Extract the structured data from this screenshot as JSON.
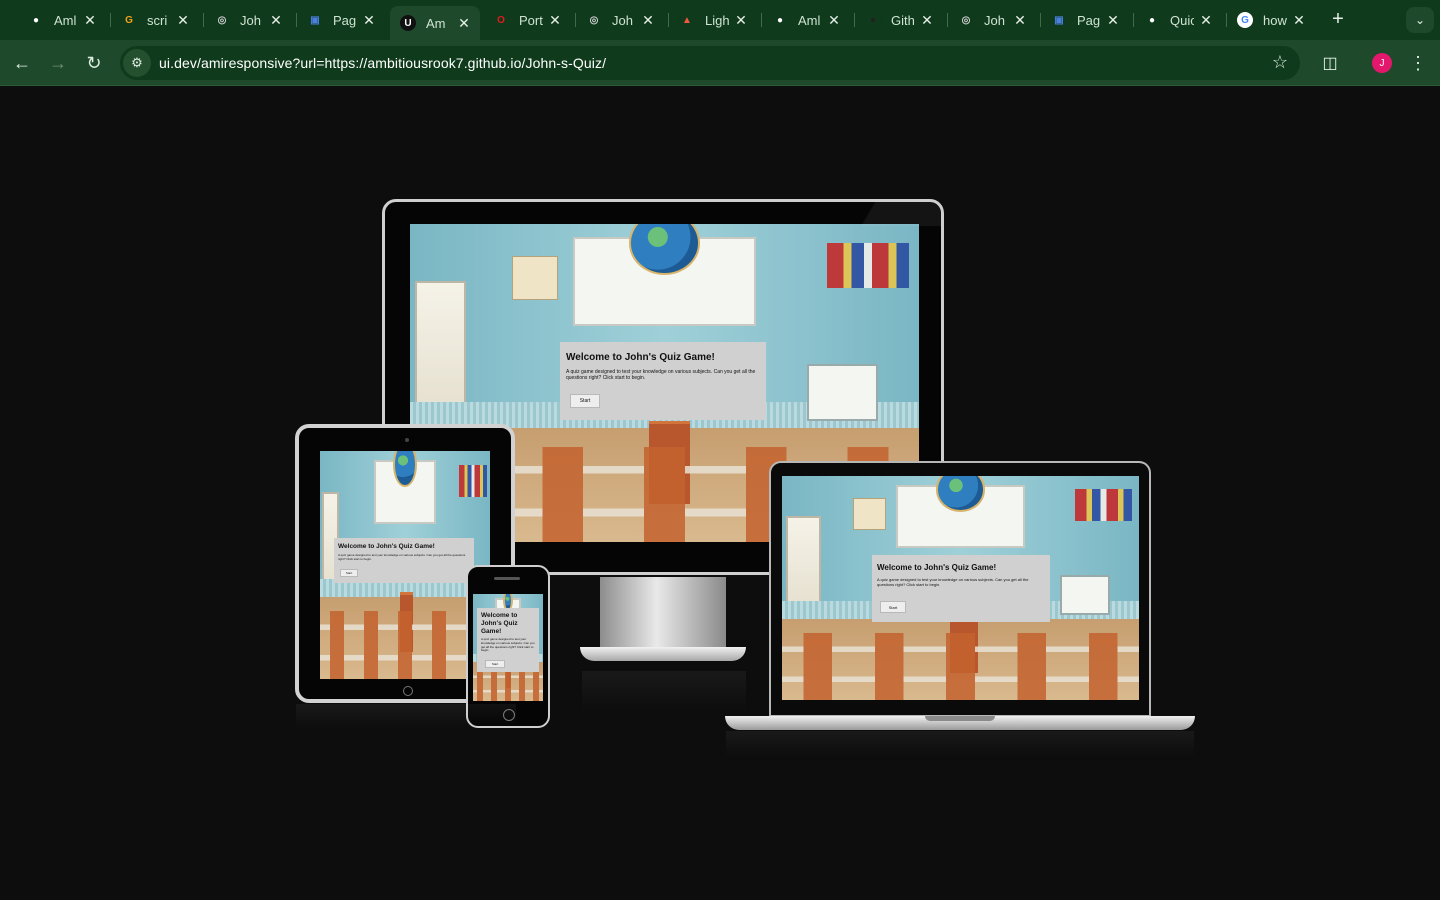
{
  "browser": {
    "tabs": [
      {
        "title": "Aml",
        "favicon": "github-icon",
        "color": "#ffffff",
        "bg": "#0f3a1c"
      },
      {
        "title": "scri",
        "favicon": "grammarly-icon",
        "color": "#f0a21a",
        "bg": "#0f3a1c"
      },
      {
        "title": "Joh",
        "favicon": "globe-icon",
        "color": "#cfcfcf",
        "bg": "#0f3a1c"
      },
      {
        "title": "Pag",
        "favicon": "pages-icon",
        "color": "#4a7fe0",
        "bg": "#0f3a1c"
      },
      {
        "title": "Am",
        "favicon": "ui-dev-icon",
        "color": "#ffffff",
        "bg": "#111111",
        "active": true
      },
      {
        "title": "Port",
        "favicon": "opera-icon",
        "color": "#e21b1b",
        "bg": "#0f3a1c"
      },
      {
        "title": "Joh",
        "favicon": "globe-icon",
        "color": "#cfcfcf",
        "bg": "#0f3a1c"
      },
      {
        "title": "Ligh",
        "favicon": "lighthouse-icon",
        "color": "#ee5b3a",
        "bg": "#0f3a1c"
      },
      {
        "title": "Aml",
        "favicon": "github-icon",
        "color": "#ffffff",
        "bg": "#0f3a1c"
      },
      {
        "title": "Gith",
        "favicon": "github-dark-icon",
        "color": "#222222",
        "bg": "#0f3a1c"
      },
      {
        "title": "Joh",
        "favicon": "globe-icon",
        "color": "#cfcfcf",
        "bg": "#0f3a1c"
      },
      {
        "title": "Pag",
        "favicon": "pages-icon",
        "color": "#4a7fe0",
        "bg": "#0f3a1c"
      },
      {
        "title": "Quic",
        "favicon": "github-icon",
        "color": "#ffffff",
        "bg": "#0f3a1c"
      },
      {
        "title": "how",
        "favicon": "google-icon",
        "color": "#4285f4",
        "bg": "#ffffff"
      }
    ],
    "url": "ui.dev/amiresponsive?url=https://ambitiousrook7.github.io/John-s-Quiz/",
    "avatar_letter": "J",
    "avatar_color": "#e3176b",
    "theme_dark": "#0f3a1c",
    "theme_light": "#1e4a2b"
  },
  "quiz": {
    "title": "Welcome to John's Quiz Game!",
    "description": "A quiz game designed to test your knowledge on various subjects. Can you get all the questions right? Click start to begin.",
    "start_label": "Start"
  }
}
